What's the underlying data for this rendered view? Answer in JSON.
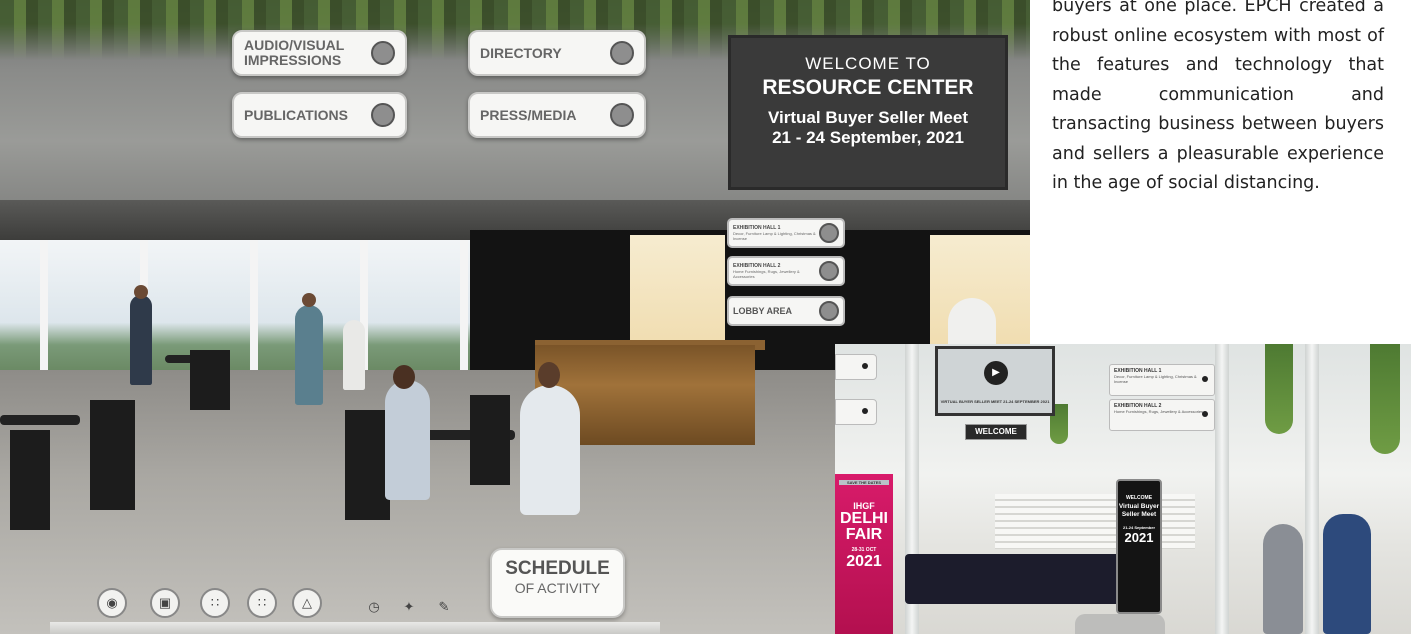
{
  "scene": {
    "signs": {
      "audio_visual": "AUDIO/VISUAL\nIMPRESSIONS",
      "directory": "DIRECTORY",
      "publications": "PUBLICATIONS",
      "press_media": "PRESS/MEDIA"
    },
    "welcome_board": {
      "line1": "WELCOME TO",
      "line2": "RESOURCE CENTER",
      "line3": "Virtual Buyer Seller Meet",
      "line4": "21 - 24 September, 2021"
    },
    "hall_signs": [
      {
        "title": "EXHIBITION HALL 1",
        "subtitle": "Decor, Furniture Lamp & Lighting, Christmas & Incense"
      },
      {
        "title": "EXHIBITION HALL 2",
        "subtitle": "Home Furnishings, Rugs, Jewellery & Accessories"
      }
    ],
    "lobby_area": "LOBBY AREA",
    "schedule": {
      "line1": "SCHEDULE",
      "line2": "OF ACTIVITY"
    },
    "toolbar_icons": [
      "map-pin-icon",
      "video-icon",
      "meeting-icon",
      "meeting-alt-icon",
      "map-icon",
      "clock-icon",
      "share-icon",
      "chat-icon"
    ]
  },
  "paragraph": "buyers at one place. EPCH created a robust online ecosystem with most of the features and technology that made communication and transacting business between buyers and sellers a pleasurable experience in the age of social distancing.",
  "lobby_inset": {
    "video_caption": "VIRTUAL BUYER SELLER MEET 21-24 SEPTEMBER 2021",
    "welcome_banner": "WELCOME",
    "hall_signs": [
      {
        "title": "EXHIBITION HALL 1",
        "subtitle": "Decor, Furniture Lamp & Lighting, Christmas & Incense"
      },
      {
        "title": "EXHIBITION HALL 2",
        "subtitle": "Home Furnishings, Rugs, Jewellery & Accessories"
      }
    ],
    "delhi_fair": {
      "tag": "SAVE THE DATES",
      "brand": "IHGF",
      "name1": "DELHI",
      "name2": "FAIR",
      "dates": "28-31 OCT",
      "year": "2021"
    },
    "standee": {
      "line1": "WELCOME",
      "line2": "Virtual Buyer Seller Meet",
      "line3": "21-24 September",
      "year": "2021"
    }
  }
}
